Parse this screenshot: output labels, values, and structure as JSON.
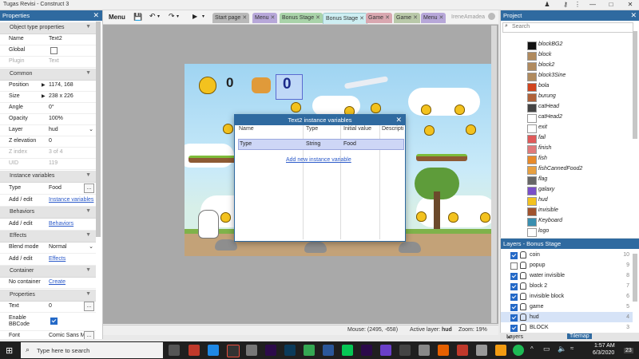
{
  "window": {
    "title": "Tugas Revisi - Construct 3",
    "controls": [
      "—",
      "□",
      "✕"
    ]
  },
  "properties_panel": {
    "title": "Properties",
    "close": "✕",
    "object_type_section": "Object type properties",
    "rows_top": [
      {
        "label": "Name",
        "value": "Text2"
      },
      {
        "label": "Global",
        "value": ""
      },
      {
        "label": "Plugin",
        "value": "Text"
      }
    ],
    "common_section": "Common",
    "rows_common": [
      {
        "label": "Position",
        "value": "1174, 168"
      },
      {
        "label": "Size",
        "value": "238 x 226"
      },
      {
        "label": "Angle",
        "value": "0°"
      },
      {
        "label": "Opacity",
        "value": "100%"
      },
      {
        "label": "Layer",
        "value": "hud"
      },
      {
        "label": "Z elevation",
        "value": "0"
      },
      {
        "label": "Z index",
        "value": "3 of 4"
      },
      {
        "label": "UID",
        "value": "119"
      }
    ],
    "instance_vars_section": "Instance variables",
    "iv_type": {
      "label": "Type",
      "value": "Food"
    },
    "iv_add": {
      "label": "Add / edit",
      "link": "Instance variables"
    },
    "behaviors_section": "Behaviors",
    "beh_add": {
      "label": "Add / edit",
      "link": "Behaviors"
    },
    "effects_section": "Effects",
    "blend": {
      "label": "Blend mode",
      "value": "Normal"
    },
    "eff_add": {
      "label": "Add / edit",
      "link": "Effects"
    },
    "container_section": "Container",
    "container": {
      "label": "No container",
      "link": "Create"
    },
    "properties_section": "Properties",
    "text_row": {
      "label": "Text",
      "value": "0"
    },
    "bbcode_label": "Enable",
    "bbcode_label2": "BBCode",
    "font_row": {
      "label": "Font",
      "value": "Comic Sans M"
    }
  },
  "toolbar": {
    "menu": "Menu",
    "tabs": [
      {
        "label": "Start page",
        "color": "#b9b9b9"
      },
      {
        "label": "Menu",
        "color": "#b7a7d9"
      },
      {
        "label": "Bonus Stage",
        "color": "#a9d3a9"
      },
      {
        "label": "Bonus Stage",
        "color": "#cdeef2"
      },
      {
        "label": "Game",
        "color": "#d9a7b0"
      },
      {
        "label": "Game",
        "color": "#b9c9a9"
      },
      {
        "label": "Menu",
        "color": "#b7a7d9"
      }
    ],
    "user": "IreneAmadea"
  },
  "stage": {
    "score_left": "0",
    "score_right": "0"
  },
  "dialog": {
    "title": "Text2 instance variables",
    "columns": [
      "Name",
      "Type",
      "Initial value",
      "Descripti"
    ],
    "row": {
      "name": "Type",
      "type": "String",
      "initial": "Food"
    },
    "add_link": "Add new instance variable"
  },
  "status": {
    "mouse": "Mouse: (2495, -658)",
    "active_layer_label": "Active layer:",
    "active_layer": "hud",
    "zoom": "Zoom: 19%"
  },
  "project_panel": {
    "title": "Project",
    "search_placeholder": "Search",
    "items": [
      {
        "label": "blockBG2",
        "icon": "#111111"
      },
      {
        "label": "block",
        "icon": "#b08a5e"
      },
      {
        "label": "block2",
        "icon": "#b08a5e"
      },
      {
        "label": "block3Sine",
        "icon": "#b08a5e"
      },
      {
        "label": "bola",
        "icon": "#d1451f"
      },
      {
        "label": "burung",
        "icon": "#b0623a"
      },
      {
        "label": "catHead",
        "icon": "#444444"
      },
      {
        "label": "catHead2",
        "icon": "#ffffff"
      },
      {
        "label": "exit",
        "icon": "#ffffff"
      },
      {
        "label": "fail",
        "icon": "#e05a5a"
      },
      {
        "label": "finish",
        "icon": "#e07a7a"
      },
      {
        "label": "fish",
        "icon": "#e88a2a"
      },
      {
        "label": "fishCannedFood2",
        "icon": "#e8a040"
      },
      {
        "label": "flag",
        "icon": "#666666"
      },
      {
        "label": "galaxy",
        "icon": "#7a4fc9"
      },
      {
        "label": "hud",
        "icon": "#f3c21e"
      },
      {
        "label": "invisible",
        "icon": "#a0522d"
      },
      {
        "label": "Keyboard",
        "icon": "#3a8fb0"
      },
      {
        "label": "logo",
        "icon": "#ffffff"
      }
    ]
  },
  "layers_panel": {
    "title": "Layers - Bonus Stage",
    "layers": [
      {
        "name": "coin",
        "num": "10",
        "checked": true
      },
      {
        "name": "popup",
        "num": "9",
        "checked": false
      },
      {
        "name": "water invisible",
        "num": "8",
        "checked": true
      },
      {
        "name": "block 2",
        "num": "7",
        "checked": true
      },
      {
        "name": "invisible block",
        "num": "6",
        "checked": true
      },
      {
        "name": "game",
        "num": "5",
        "checked": true
      },
      {
        "name": "hud",
        "num": "4",
        "checked": true
      },
      {
        "name": "BLOCK",
        "num": "3",
        "checked": true
      }
    ],
    "tab1": "Layers - Bonus Stage",
    "tab2": "Tilemap"
  },
  "taskbar": {
    "search_placeholder": "Type here to search",
    "time": "1:57 AM",
    "date": "6/3/2020",
    "notif": "23"
  }
}
